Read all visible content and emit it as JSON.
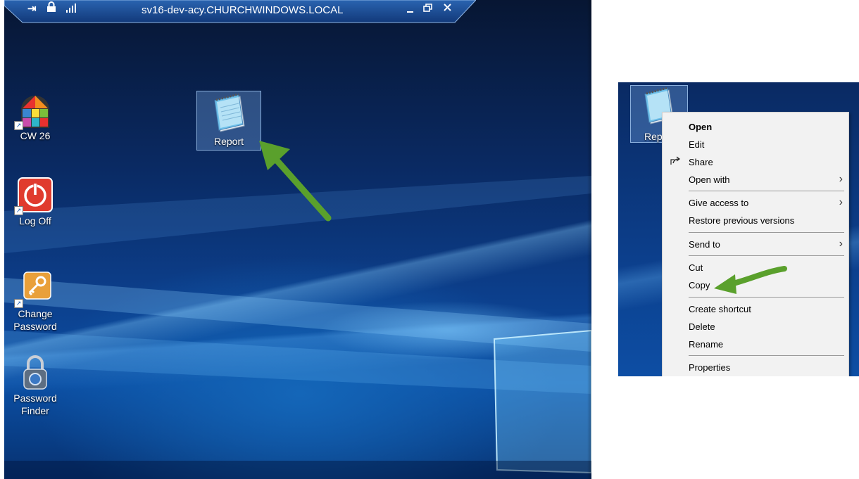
{
  "rdp_bar": {
    "title": "sv16-dev-acy.CHURCHWINDOWS.LOCAL",
    "pin_icon": "pin-icon",
    "lock_icon": "lock-icon",
    "signal_icon": "signal-icon",
    "minimize_icon": "minimize-icon",
    "restore_icon": "restore-icon",
    "close_icon": "close-icon"
  },
  "desktop": {
    "icons": [
      {
        "label": "CW 26",
        "icon": "cw26-app-icon"
      },
      {
        "label": "Log Off",
        "icon": "power-icon"
      },
      {
        "label_line1": "Change",
        "label_line2": "Password",
        "icon": "key-icon"
      },
      {
        "label_line1": "Password",
        "label_line2": "Finder",
        "icon": "padlock-icon"
      }
    ],
    "selected_file": {
      "label": "Report",
      "icon": "notepad-file-icon"
    }
  },
  "context_view": {
    "file_label": "Repo",
    "menu": {
      "open": "Open",
      "edit": "Edit",
      "share": "Share",
      "open_with": "Open with",
      "give_access_to": "Give access to",
      "restore_previous_versions": "Restore previous versions",
      "send_to": "Send to",
      "cut": "Cut",
      "copy": "Copy",
      "create_shortcut": "Create shortcut",
      "delete": "Delete",
      "rename": "Rename",
      "properties": "Properties"
    },
    "submenu_chevron": "›"
  },
  "colors": {
    "arrow_green": "#5aa02c",
    "rdp_bar_blue": "#1e4f96",
    "menu_background": "#f2f2f2"
  }
}
